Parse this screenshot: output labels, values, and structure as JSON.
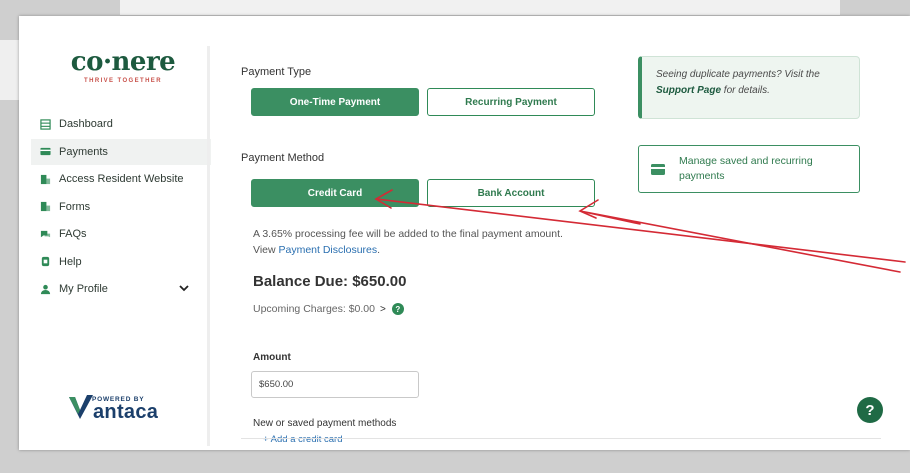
{
  "brand": {
    "logo": "co·nere",
    "tagline": "THRIVE TOGETHER",
    "powered_small": "POWERED BY",
    "powered_name": "antaca",
    "primary_color": "#3b8f62",
    "dark_color": "#1d5a3f"
  },
  "sidebar": {
    "items": [
      {
        "label": "Dashboard",
        "icon": "dashboard-icon"
      },
      {
        "label": "Payments",
        "icon": "credit-card-icon",
        "active": true
      },
      {
        "label": "Access Resident Website",
        "icon": "building-icon"
      },
      {
        "label": "Forms",
        "icon": "form-icon"
      },
      {
        "label": "FAQs",
        "icon": "faq-icon"
      },
      {
        "label": "Help",
        "icon": "help-icon"
      },
      {
        "label": "My Profile",
        "icon": "user-icon",
        "chevron": "⌄"
      }
    ]
  },
  "payment": {
    "type_label": "Payment Type",
    "type_options": [
      "One-Time Payment",
      "Recurring Payment"
    ],
    "type_selected": "One-Time Payment",
    "method_label": "Payment Method",
    "method_options": [
      "Credit Card",
      "Bank Account"
    ],
    "method_selected": "Credit Card",
    "fee_text": "A 3.65% processing fee will be added to the final payment amount.",
    "fee_view": "View ",
    "fee_link": "Payment Disclosures",
    "fee_end": ".",
    "balance": "Balance Due: $650.00",
    "upcoming": "Upcoming Charges: $0.00",
    "upcoming_chevron": ">",
    "amount_label": "Amount",
    "amount_value": "$650.00",
    "methods_label": "New or saved payment methods",
    "add_card": "+ Add a credit card"
  },
  "notice": {
    "prefix": "Seeing duplicate payments? Visit the ",
    "link": "Support Page",
    "suffix": " for details."
  },
  "manage": {
    "label": "Manage saved and recurring payments"
  },
  "help_fab": "?",
  "annotation_color": "#d42a35"
}
